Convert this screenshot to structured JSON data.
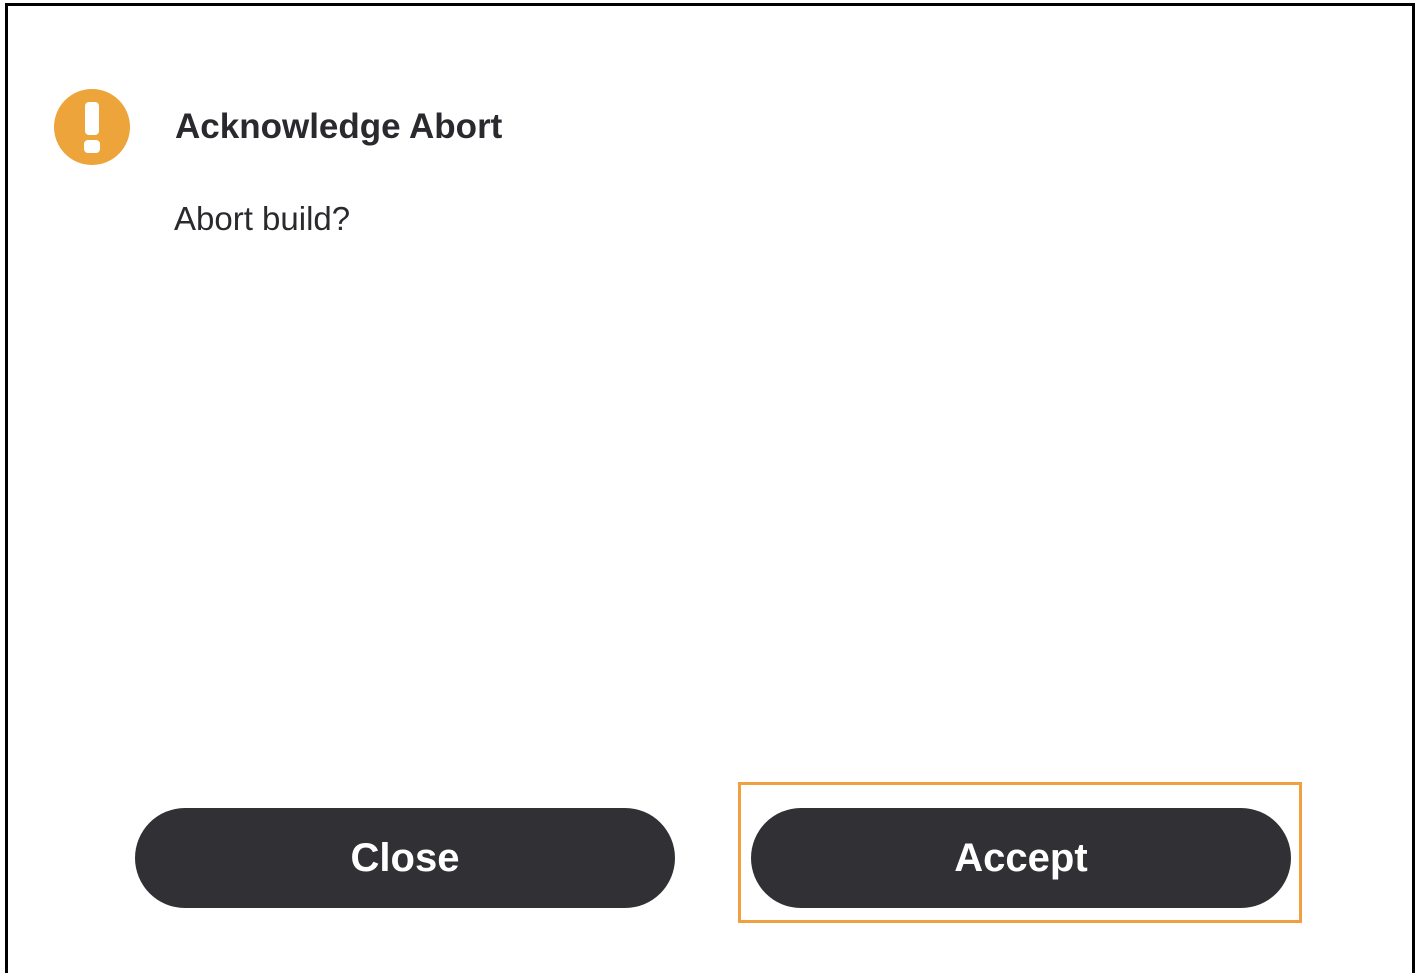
{
  "dialog": {
    "icon": "warning-exclamation-icon",
    "icon_color": "#eda43a",
    "title": "Acknowledge Abort",
    "message": "Abort build?",
    "buttons": {
      "close_label": "Close",
      "accept_label": "Accept"
    },
    "button_color": "#303035",
    "focus_highlight_color": "#f0a040",
    "focused_button": "Accept"
  }
}
